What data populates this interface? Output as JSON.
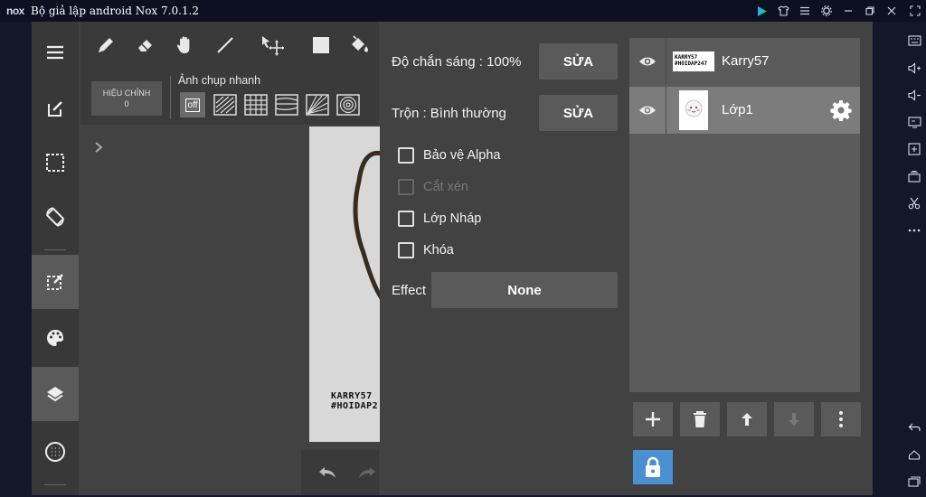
{
  "window": {
    "logo": "nox",
    "title": "Bộ giả lập android Nox 7.0.1.2",
    "controls": [
      "play-store-icon",
      "shirt-icon",
      "menu-icon",
      "gear-icon",
      "minimize-icon",
      "restore-icon",
      "close-icon"
    ]
  },
  "nox_sidebar": {
    "items": [
      "keyboard-icon",
      "volume-up-icon",
      "volume-down-icon",
      "screen-icon",
      "add-apk-icon",
      "multi-instance-icon",
      "scissors-icon",
      "more-icon",
      "back-icon",
      "home-icon",
      "recent-apps-icon"
    ]
  },
  "left_toolbar": {
    "items": [
      "menu-icon",
      "edit-icon",
      "selection-icon",
      "rotate-icon",
      "layer-edit-icon",
      "palette-icon",
      "layers-icon",
      "grid-icon"
    ]
  },
  "top_tools": {
    "items": [
      "pencil-icon",
      "eraser-icon",
      "hand-icon",
      "line-icon",
      "move-icon",
      "fill-rect-icon",
      "bucket-icon"
    ]
  },
  "snapshot": {
    "adjust_label": "HIỆU CHỈNH",
    "adjust_value": "0",
    "label": "Ảnh chụp nhanh",
    "off_label": "off"
  },
  "canvas": {
    "watermark_line1": "KARRY57",
    "watermark_line2": "#HOIDAP2"
  },
  "properties": {
    "opacity_label": "Độ chắn sáng : 100%",
    "opacity_edit": "SỬA",
    "blend_label": "Trộn : Bình thường",
    "blend_edit": "SỬA",
    "checkboxes": [
      {
        "label": "Bảo vệ Alpha",
        "enabled": true,
        "checked": false
      },
      {
        "label": "Cắt xén",
        "enabled": false,
        "checked": false
      },
      {
        "label": "Lớp Nháp",
        "enabled": true,
        "checked": false
      },
      {
        "label": "Khóa",
        "enabled": true,
        "checked": false
      }
    ],
    "effect_label": "Effect",
    "effect_value": "None"
  },
  "layers": {
    "items": [
      {
        "name": "Karry57",
        "thumb_line1": "KARRY57",
        "thumb_line2": "#HOIDAP247",
        "selected": false
      },
      {
        "name": "Lớp1",
        "selected": true
      }
    ],
    "actions": [
      "add-layer-icon",
      "delete-layer-icon",
      "move-up-icon",
      "move-down-icon",
      "more-options-icon"
    ],
    "lock": "lock-icon"
  },
  "colors": {
    "accent": "#4a8fd0",
    "panel": "#424242",
    "button": "#5a5a5a",
    "selected_layer": "#7c7c7c"
  }
}
